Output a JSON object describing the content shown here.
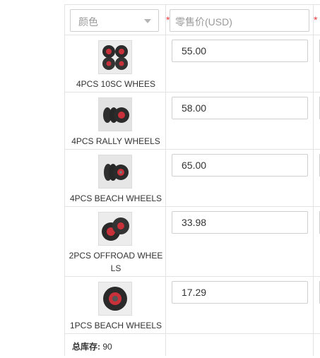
{
  "header": {
    "color_select_value": "颜色",
    "price_placeholder": "零售价(USD)",
    "required_mark": "*"
  },
  "rows": [
    {
      "name": "4PCS 10SC WHEES",
      "price": "55.00"
    },
    {
      "name": "4PCS RALLY WHEELS",
      "price": "58.00"
    },
    {
      "name": "4PCS BEACH WHEELS",
      "price": "65.00"
    },
    {
      "name": "2PCS OFFROAD WHEE LS",
      "price": "33.98"
    },
    {
      "name": "1PCS BEACH WHEELS",
      "price": "17.29"
    }
  ],
  "footer": {
    "stock_label": "总库存:",
    "stock_value": "90"
  },
  "icons": {
    "select_caret": "chevron-down-icon",
    "thumb": "wheel-product-image"
  },
  "colors": {
    "border": "#e3e3e3",
    "required": "#e4393c",
    "wheel_accent": "#c8303a"
  }
}
